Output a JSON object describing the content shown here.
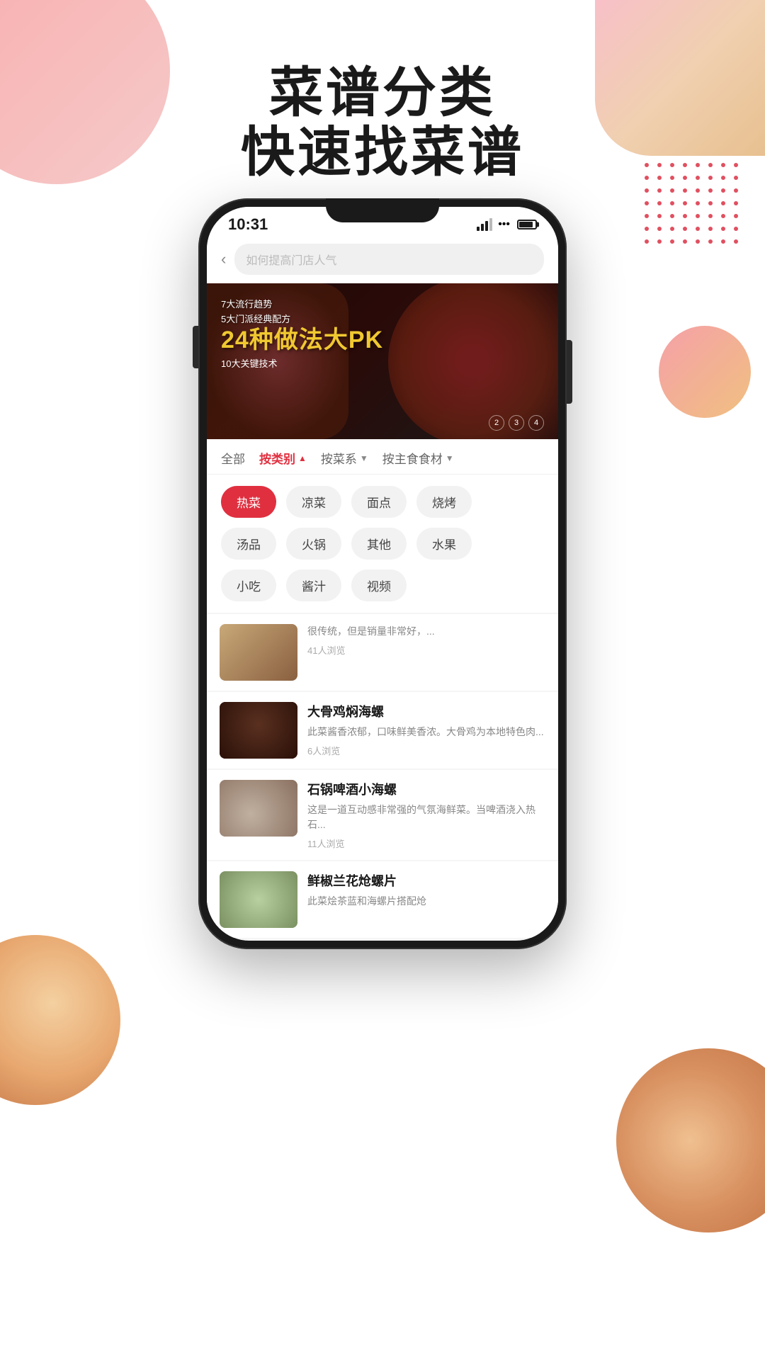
{
  "app": {
    "title": "菜谱分类",
    "subtitle": "快速找菜谱"
  },
  "status_bar": {
    "time": "10:31",
    "signal": "signal",
    "wifi": "wifi",
    "battery": "battery"
  },
  "search": {
    "placeholder": "如何提高门店人气"
  },
  "banner": {
    "line1": "7大流行趋势",
    "line2": "5大门派经典配方",
    "main": "24种做法大PK",
    "line3": "10大关键技术",
    "page_indicators": [
      "2",
      "3",
      "4"
    ]
  },
  "filter_tabs": [
    {
      "label": "全部",
      "active": false
    },
    {
      "label": "按类别",
      "active": true,
      "arrow": "▲"
    },
    {
      "label": "按菜系",
      "active": false,
      "arrow": "▼"
    },
    {
      "label": "按主食食材",
      "active": false,
      "arrow": "▼"
    }
  ],
  "categories": [
    [
      "热菜",
      "凉菜",
      "面点",
      "烧烤"
    ],
    [
      "汤品",
      "火锅",
      "其他",
      "水果"
    ],
    [
      "小吃",
      "酱汁",
      "视频"
    ]
  ],
  "active_category": "热菜",
  "recipes": [
    {
      "title": "大骨鸡焖海螺",
      "desc": "此菜酱香浓郁，口味鲜美香浓。大骨鸡为本地特色肉...",
      "views": "6人浏览",
      "thumb_class": "thumb-2"
    },
    {
      "title": "石锅啤酒小海螺",
      "desc": "这是一道互动感非常强的气氛海鲜菜。当啤酒浇入热石...",
      "views": "11人浏览",
      "thumb_class": "thumb-3"
    },
    {
      "title": "鲜椒兰花炝螺片",
      "desc": "此菜烩茶蓝和海螺片搭配炝",
      "views": "",
      "thumb_class": "thumb-4"
    }
  ],
  "above_recipe_desc": "很传统，但是销量非常好，...",
  "above_recipe_views": "41人浏览",
  "colors": {
    "accent": "#e03040",
    "text_dark": "#1a1a1a",
    "text_light": "#888888"
  }
}
